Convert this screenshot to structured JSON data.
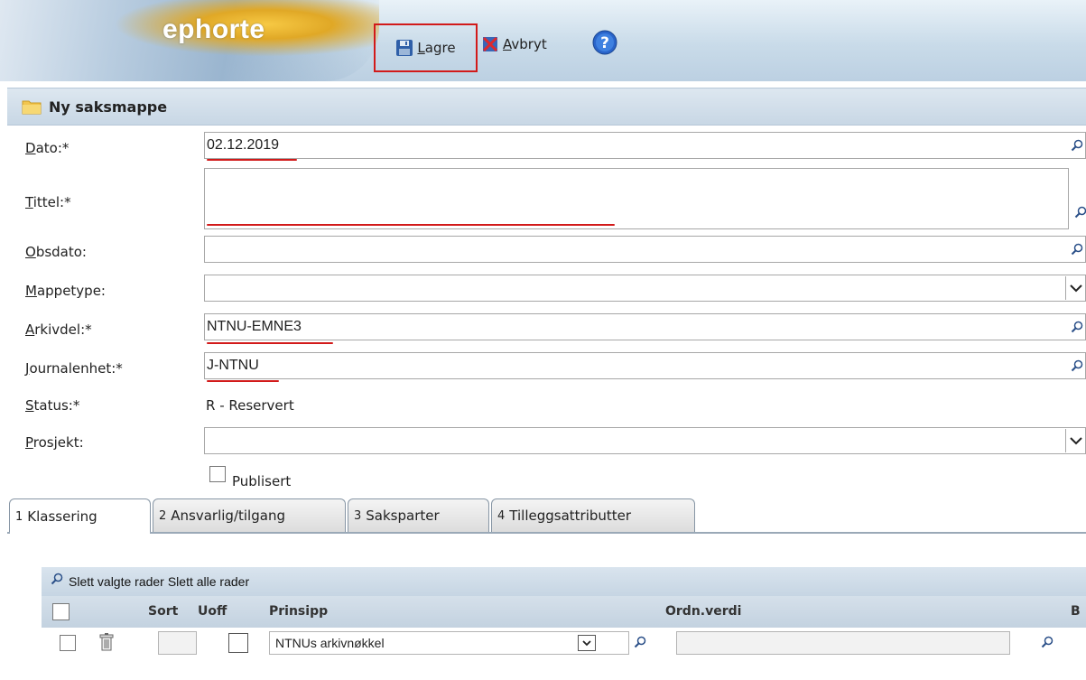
{
  "header": {
    "logo": "ephorte",
    "save_label_first": "L",
    "save_label_rest": "agre",
    "cancel_label_first": "A",
    "cancel_label_rest": "vbryt"
  },
  "panel": {
    "title": "Ny saksmappe"
  },
  "form": {
    "dato": {
      "label_first": "D",
      "label_rest": "ato:*",
      "value": "02.12.2019"
    },
    "tittel": {
      "label_first": "T",
      "label_rest": "ittel:*",
      "value": ""
    },
    "obsdato": {
      "label_first": "O",
      "label_rest": "bsdato:",
      "value": ""
    },
    "mappetype": {
      "label_first": "M",
      "label_rest": "appetype:",
      "value": ""
    },
    "arkivdel": {
      "label_first": "A",
      "label_rest": "rkivdel:*",
      "value": "NTNU-EMNE3"
    },
    "journalenhet": {
      "label_first": "J",
      "label_rest": "ournalenhet:*",
      "value": "J-NTNU"
    },
    "status": {
      "label_first": "S",
      "label_rest": "tatus:*",
      "value": "R - Reservert"
    },
    "prosjekt": {
      "label_first": "P",
      "label_rest": "rosjekt:",
      "value": ""
    },
    "publisert": {
      "label": "Publisert",
      "checked": false
    }
  },
  "tabs": [
    {
      "num": "1",
      "label": "Klassering"
    },
    {
      "num": "2",
      "label": "Ansvarlig/tilgang"
    },
    {
      "num": "3",
      "label": "Saksparter"
    },
    {
      "num": "4",
      "label": "Tilleggsattributter"
    }
  ],
  "table": {
    "toolbar": {
      "delete_selected": "Slett valgte rader",
      "delete_all": "Slett alle rader"
    },
    "columns": {
      "sort": "Sort",
      "uoff": "Uoff",
      "prinsipp": "Prinsipp",
      "ordnverdi": "Ordn.verdi",
      "b": "B"
    },
    "row": {
      "prinsipp": "NTNUs arkivnøkkel",
      "ordnverdi": ""
    }
  },
  "colors": {
    "accent_red": "#d21a1a",
    "header_blue": "#c9dbe9"
  }
}
